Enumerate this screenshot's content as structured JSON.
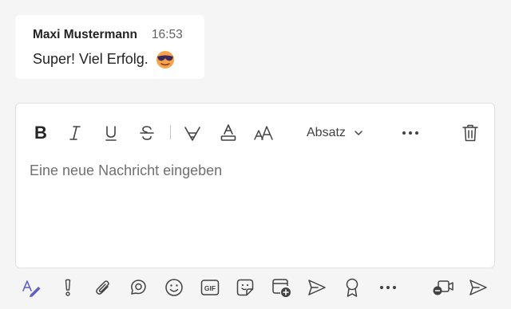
{
  "message": {
    "author": "Maxi Mustermann",
    "time": "16:53",
    "text": "Super! Viel Erfolg.",
    "emoji_icon": "smiling-face-with-sunglasses"
  },
  "formatting_toolbar": {
    "bold": "B",
    "paragraph_label": "Absatz"
  },
  "compose": {
    "placeholder": "Eine neue Nachricht eingeben"
  },
  "colors": {
    "accent": "#5b5fc7",
    "text": "#242424",
    "muted": "#707070",
    "background": "#f5f5f5"
  }
}
